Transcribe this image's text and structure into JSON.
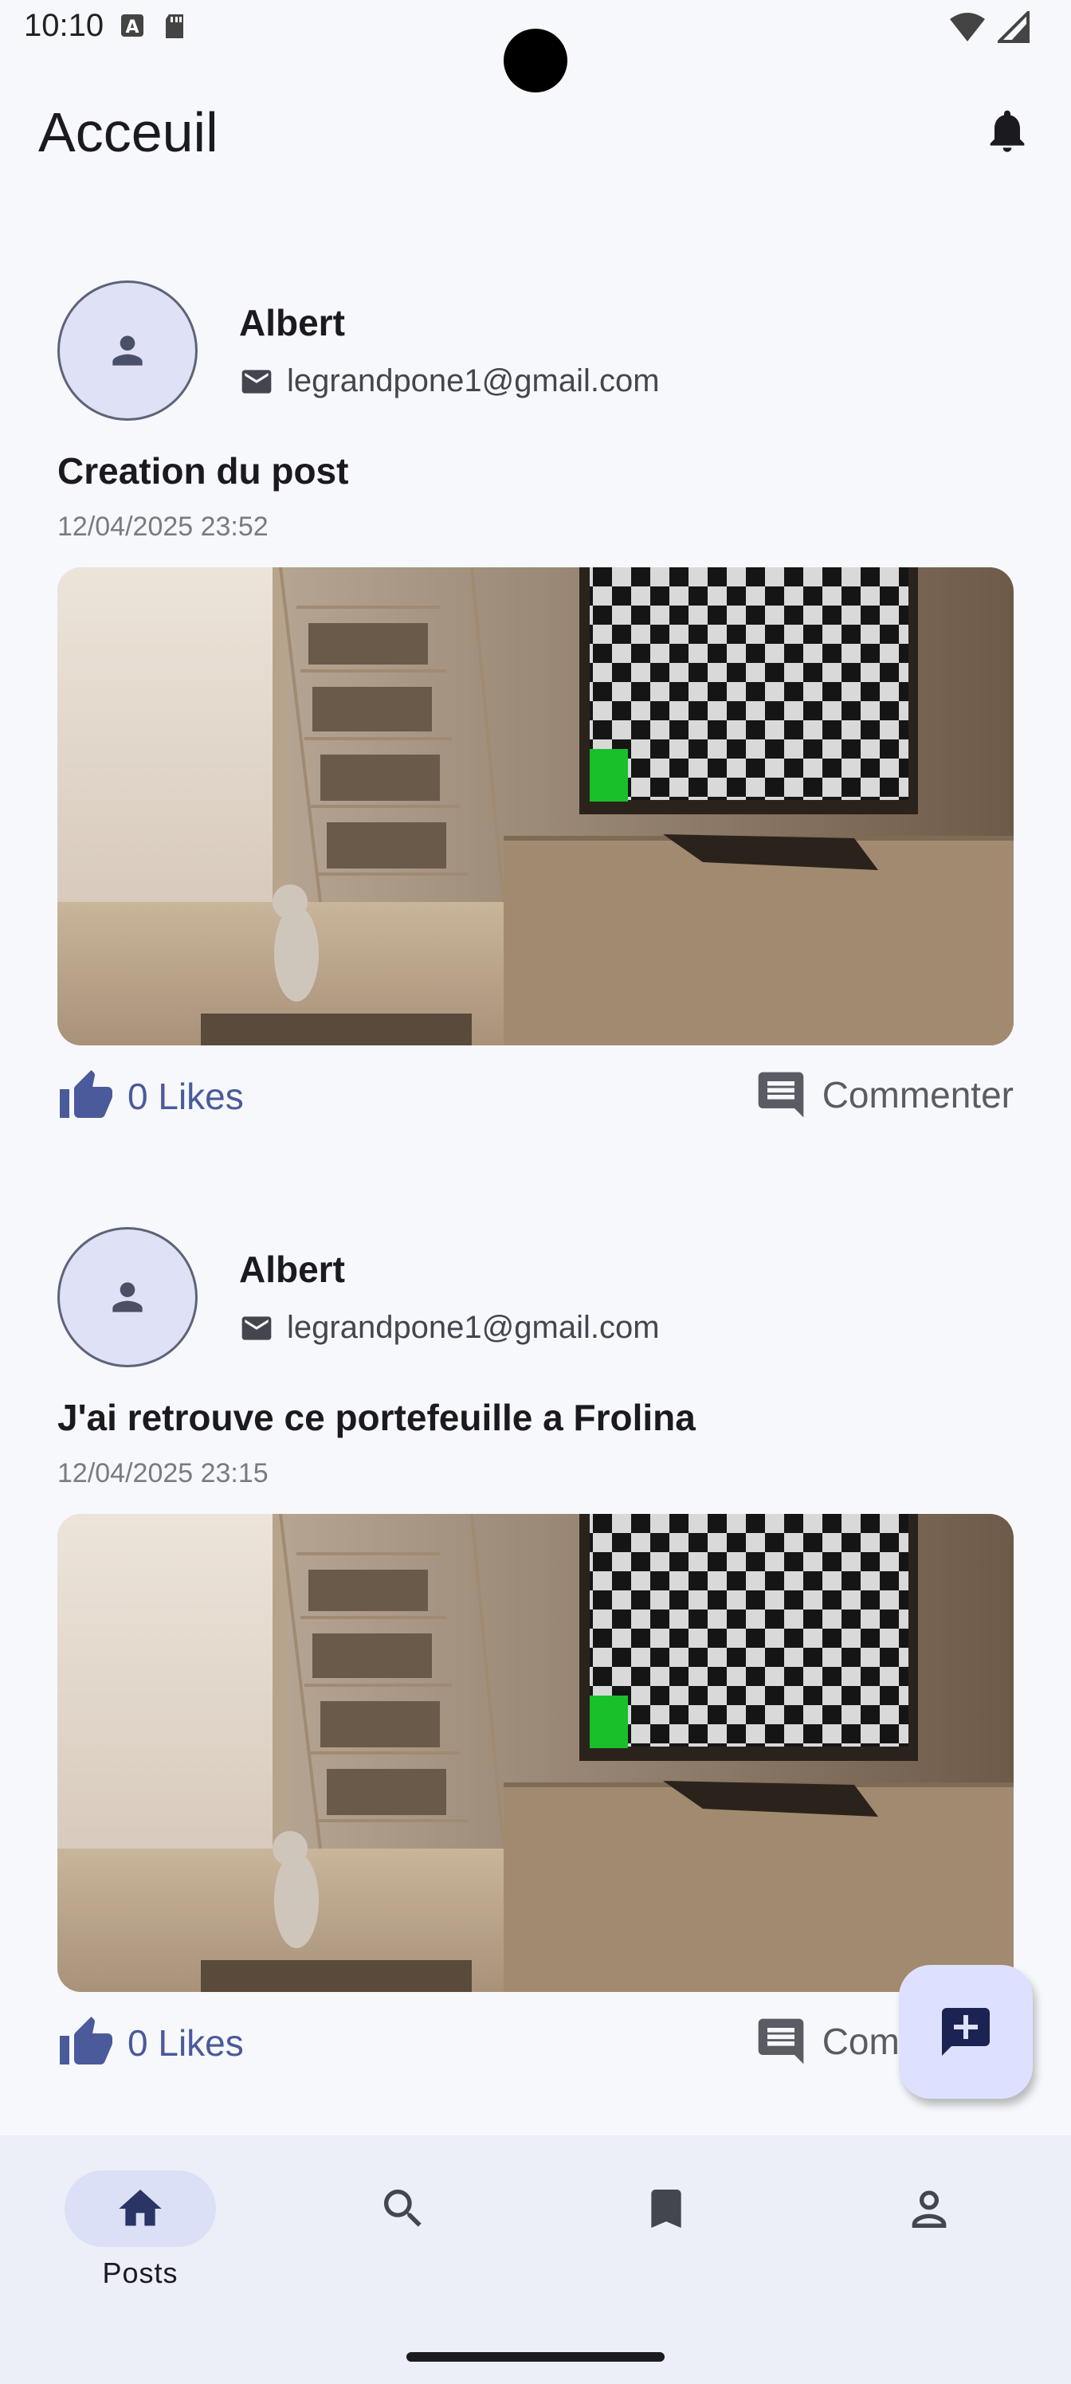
{
  "status_bar": {
    "time": "10:10"
  },
  "app_bar": {
    "title": "Acceuil",
    "notification_icon": "bell-icon"
  },
  "posts": [
    {
      "author": "Albert",
      "email": "legrandpone1@gmail.com",
      "title": "Creation du post",
      "date": "12/04/2025 23:52",
      "likes_label": "0 Likes",
      "comment_label": "Commenter"
    },
    {
      "author": "Albert",
      "email": "legrandpone1@gmail.com",
      "title": "J'ai retrouve ce portefeuille a Frolina",
      "date": "12/04/2025 23:15",
      "likes_label": "0 Likes",
      "comment_label": "Commenter"
    }
  ],
  "fab": {
    "icon": "add-comment-icon"
  },
  "bottom_nav": {
    "items": [
      {
        "label": "Posts",
        "icon": "home-icon",
        "active": true
      },
      {
        "label": "",
        "icon": "search-icon",
        "active": false
      },
      {
        "label": "",
        "icon": "bookmark-icon",
        "active": false
      },
      {
        "label": "",
        "icon": "person-icon",
        "active": false
      }
    ]
  },
  "colors": {
    "accent": "#4a5a9a",
    "background": "#f7f8fc",
    "nav_background": "#eceef8",
    "fab_background": "#dde1ff"
  }
}
